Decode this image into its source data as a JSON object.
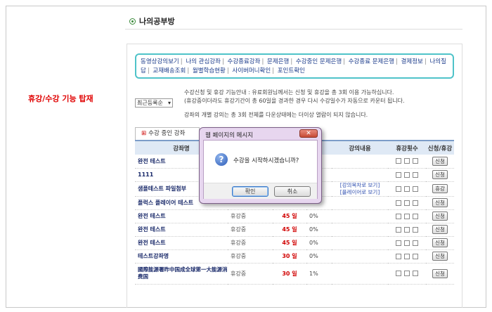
{
  "left_label": "휴강/수강 기능 탑재",
  "page_title": "나의공부방",
  "nav": {
    "links": [
      "동영상강의보기",
      "나의 관심강좌",
      "수강종료강좌",
      "문제은행",
      "수강중인 문제은행",
      "수강종료 문제은행",
      "결제정보",
      "나의질답",
      "교재배송조회",
      "월별학습현황",
      "사이버머니확인",
      "포인트확인"
    ]
  },
  "sort_select": "최근등록순",
  "notice": {
    "line1": "수강신청 및 휴강 기능안내 : 유료회원님께서는 신청 및 휴강을 총 3회 이용 가능하십니다.",
    "line2": "(휴강중이더라도 휴강기간이 총 60일을 경과한 경우 다시 수강일수가 자동으로 카운터 됩니다.",
    "line3": "강좌의 개별 강의는 총 3회 전체를 다운상태에는 더이상 열람이 되지 않습니다."
  },
  "tab_label": "수강 중인 강좌",
  "table": {
    "headers": [
      "강좌명",
      "",
      "",
      "",
      "강의내용",
      "휴강횟수",
      "신청/휴강"
    ],
    "rows": [
      {
        "name": "완전 테스트",
        "status": "",
        "days": "",
        "pct": "",
        "links": "",
        "action": "신청"
      },
      {
        "name": "1111",
        "status": "",
        "days": "",
        "pct": "",
        "links": "",
        "action": "신청"
      },
      {
        "name": "샘플테스트 파일첨부",
        "status": "",
        "days": "",
        "pct": "",
        "link1": "[강의목차로 보기]",
        "link2": "[플레이어로 보기]",
        "action": "휴강"
      },
      {
        "name": "플럭스 플레이어 테스트",
        "status": "",
        "days": "",
        "pct": "",
        "links": "",
        "action": "신청"
      },
      {
        "name": "완전 테스트",
        "status": "휴강중",
        "days": "45 일",
        "pct": "0%",
        "links": "",
        "action": "신청"
      },
      {
        "name": "완전 테스트",
        "status": "휴강중",
        "days": "45 일",
        "pct": "0%",
        "links": "",
        "action": "신청"
      },
      {
        "name": "완전 테스트",
        "status": "휴강중",
        "days": "45 일",
        "pct": "0%",
        "links": "",
        "action": "신청"
      },
      {
        "name": "테스트강좌명",
        "status": "휴강중",
        "days": "30 일",
        "pct": "0%",
        "links": "",
        "action": "신청"
      },
      {
        "name": "國際能源署昨中国成全球第一大能源消费国",
        "status": "휴강중",
        "days": "30 일",
        "pct": "1%",
        "links": "",
        "action": "신청"
      }
    ]
  },
  "dialog": {
    "title": "웹 페이지의 메시지",
    "message": "수강을 시작하시겠습니까?",
    "ok": "확인",
    "cancel": "취소",
    "icon": "question-icon"
  }
}
